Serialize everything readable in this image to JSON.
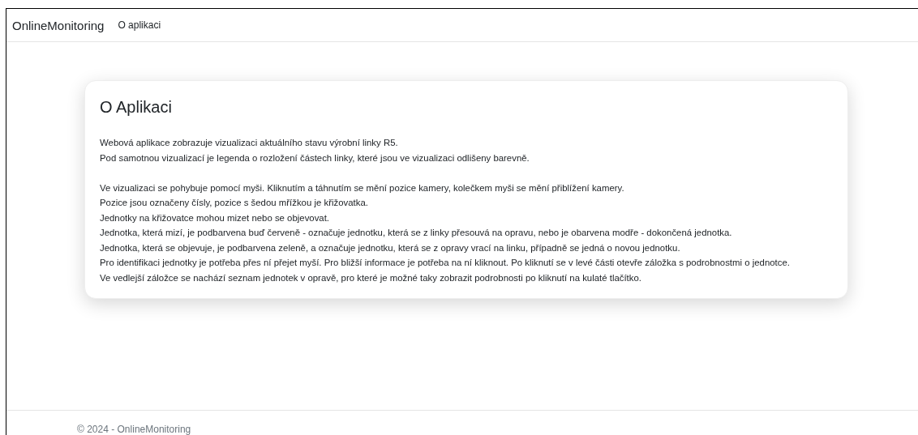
{
  "navbar": {
    "brand": "OnlineMonitoring",
    "links": [
      {
        "label": "O aplikaci"
      }
    ]
  },
  "card": {
    "title": "O Aplikaci",
    "paragraphs": [
      [
        "Webová aplikace zobrazuje vizualizaci aktuálního stavu výrobní linky R5.",
        "Pod samotnou vizualizací je legenda o rozložení částech linky, které jsou ve vizualizaci odlišeny barevně."
      ],
      [
        "Ve vizualizaci se pohybuje pomocí myši. Kliknutím a táhnutím se mění pozice kamery, kolečkem myši se mění přiblížení kamery.",
        "Pozice jsou označeny čísly, pozice s šedou mřížkou je křižovatka.",
        "Jednotky na křižovatce mohou mizet nebo se objevovat.",
        "Jednotka, která mizí, je podbarvena buď červeně - označuje jednotku, která se z linky přesouvá na opravu, nebo je obarvena modře - dokončená jednotka.",
        "Jednotka, která se objevuje, je podbarvena zeleně, a označuje jednotku, která se z opravy vrací na linku, případně se jedná o novou jednotku.",
        "Pro identifikaci jednotky je potřeba přes ní přejet myší. Pro bližší informace je potřeba na ní kliknout. Po kliknutí se v levé části otevře záložka s podrobnostmi o jednotce.",
        "Ve vedlejší záložce se nachází seznam jednotek v opravě, pro které je možné taky zobrazit podrobnosti po kliknutí na kulaté tlačítko."
      ]
    ]
  },
  "footer": {
    "text": "© 2024 - OnlineMonitoring"
  }
}
